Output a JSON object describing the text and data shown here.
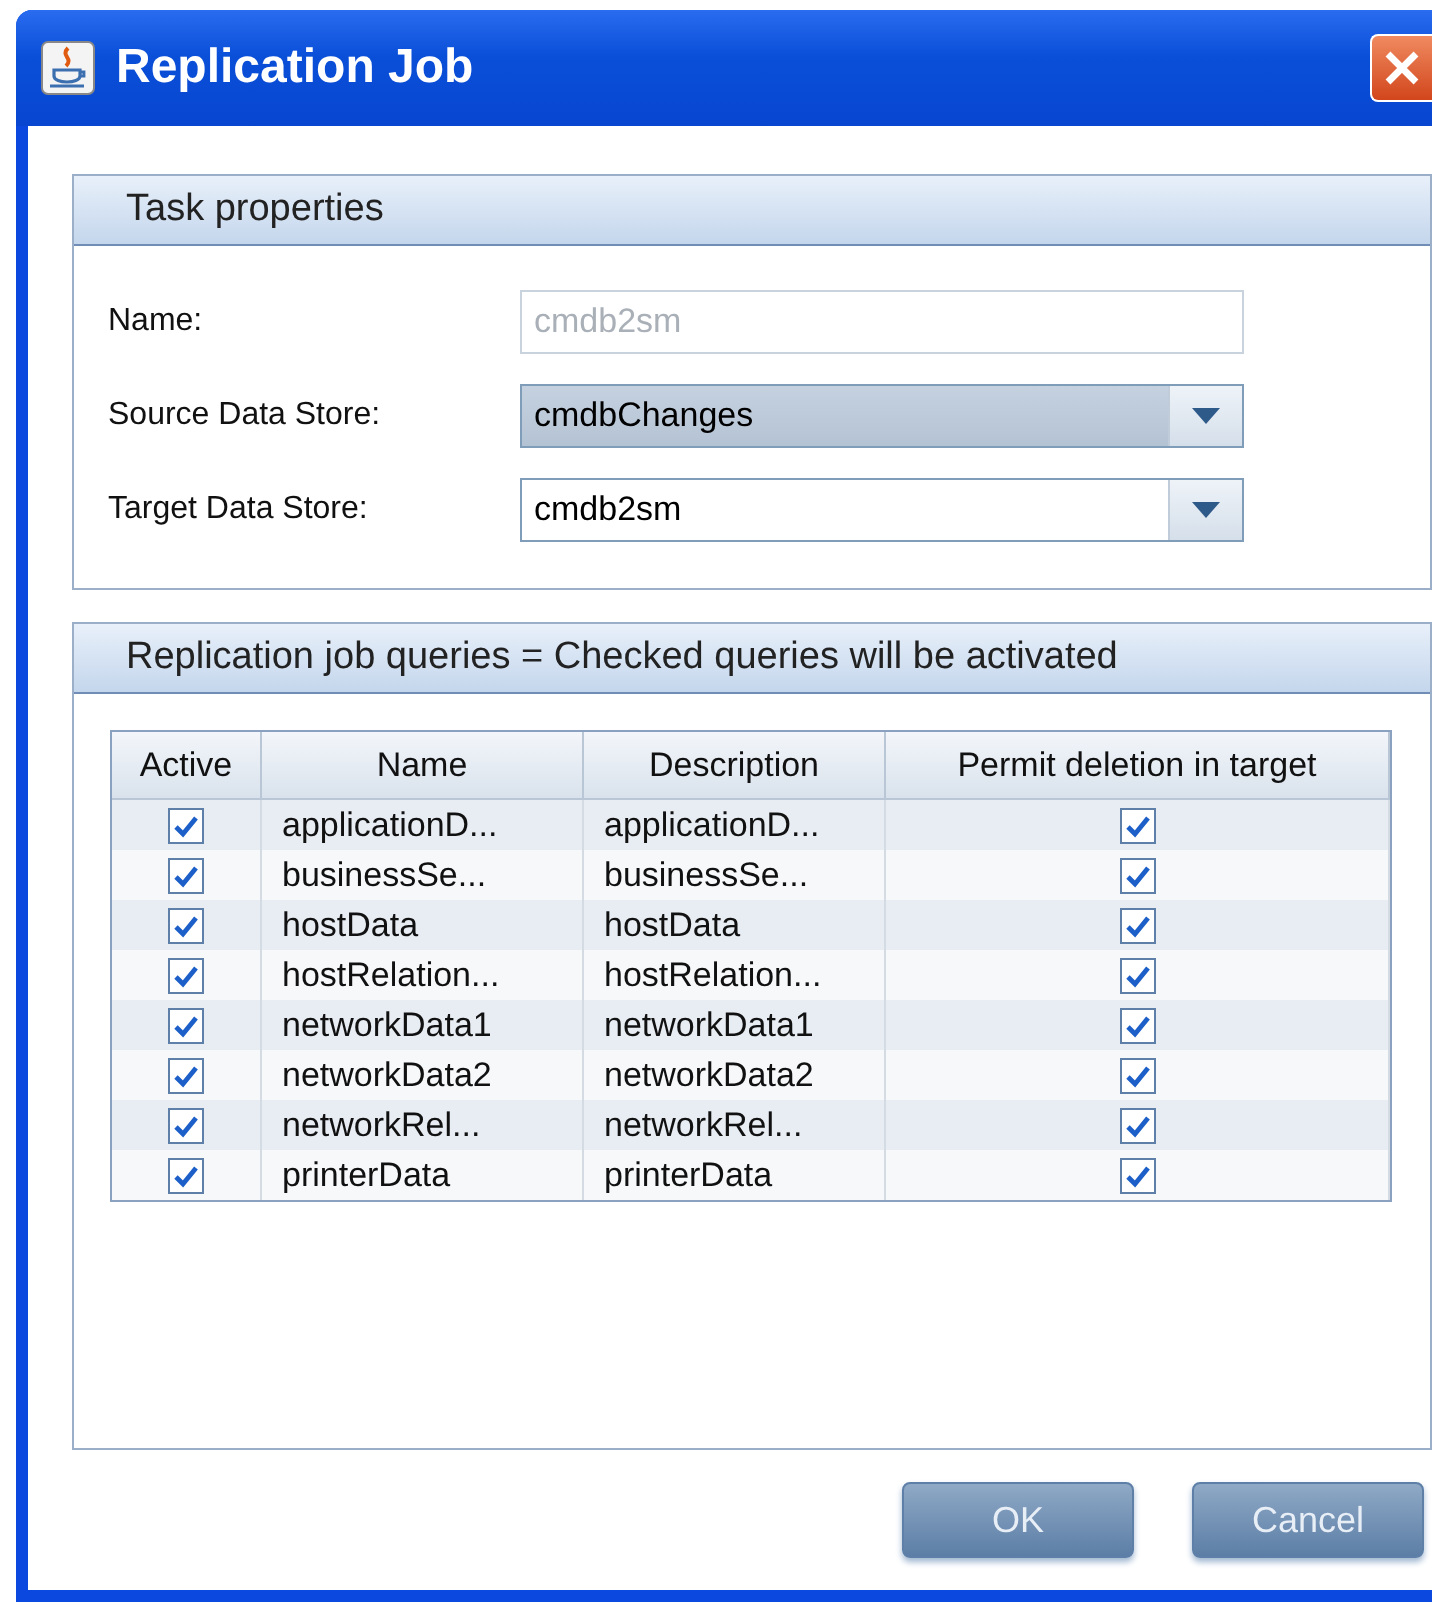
{
  "window": {
    "title": "Replication Job"
  },
  "task_properties": {
    "title": "Task properties",
    "fields": [
      {
        "kind": "text",
        "label": "Name:",
        "value": "cmdb2sm",
        "disabled": true,
        "focused": false
      },
      {
        "kind": "dropdown",
        "label": "Source Data Store:",
        "value": "cmdbChanges",
        "disabled": false,
        "focused": true
      },
      {
        "kind": "dropdown",
        "label": "Target Data Store:",
        "value": "cmdb2sm",
        "disabled": false,
        "focused": false
      }
    ]
  },
  "queries": {
    "title": "Replication job queries = Checked queries will be activated",
    "table": {
      "columns": [
        "Active",
        "Name",
        "Description",
        "Permit deletion in target"
      ],
      "rows": [
        {
          "active": true,
          "name": "applicationD...",
          "description": "applicationD...",
          "permit_deletion": true
        },
        {
          "active": true,
          "name": "businessSe...",
          "description": "businessSe...",
          "permit_deletion": true
        },
        {
          "active": true,
          "name": "hostData",
          "description": "hostData",
          "permit_deletion": true
        },
        {
          "active": true,
          "name": "hostRelation...",
          "description": "hostRelation...",
          "permit_deletion": true
        },
        {
          "active": true,
          "name": "networkData1",
          "description": "networkData1",
          "permit_deletion": true
        },
        {
          "active": true,
          "name": "networkData2",
          "description": "networkData2",
          "permit_deletion": true
        },
        {
          "active": true,
          "name": "networkRel...",
          "description": "networkRel...",
          "permit_deletion": true
        },
        {
          "active": true,
          "name": "printerData",
          "description": "printerData",
          "permit_deletion": true
        }
      ]
    }
  },
  "buttons": [
    "OK",
    "Cancel"
  ]
}
